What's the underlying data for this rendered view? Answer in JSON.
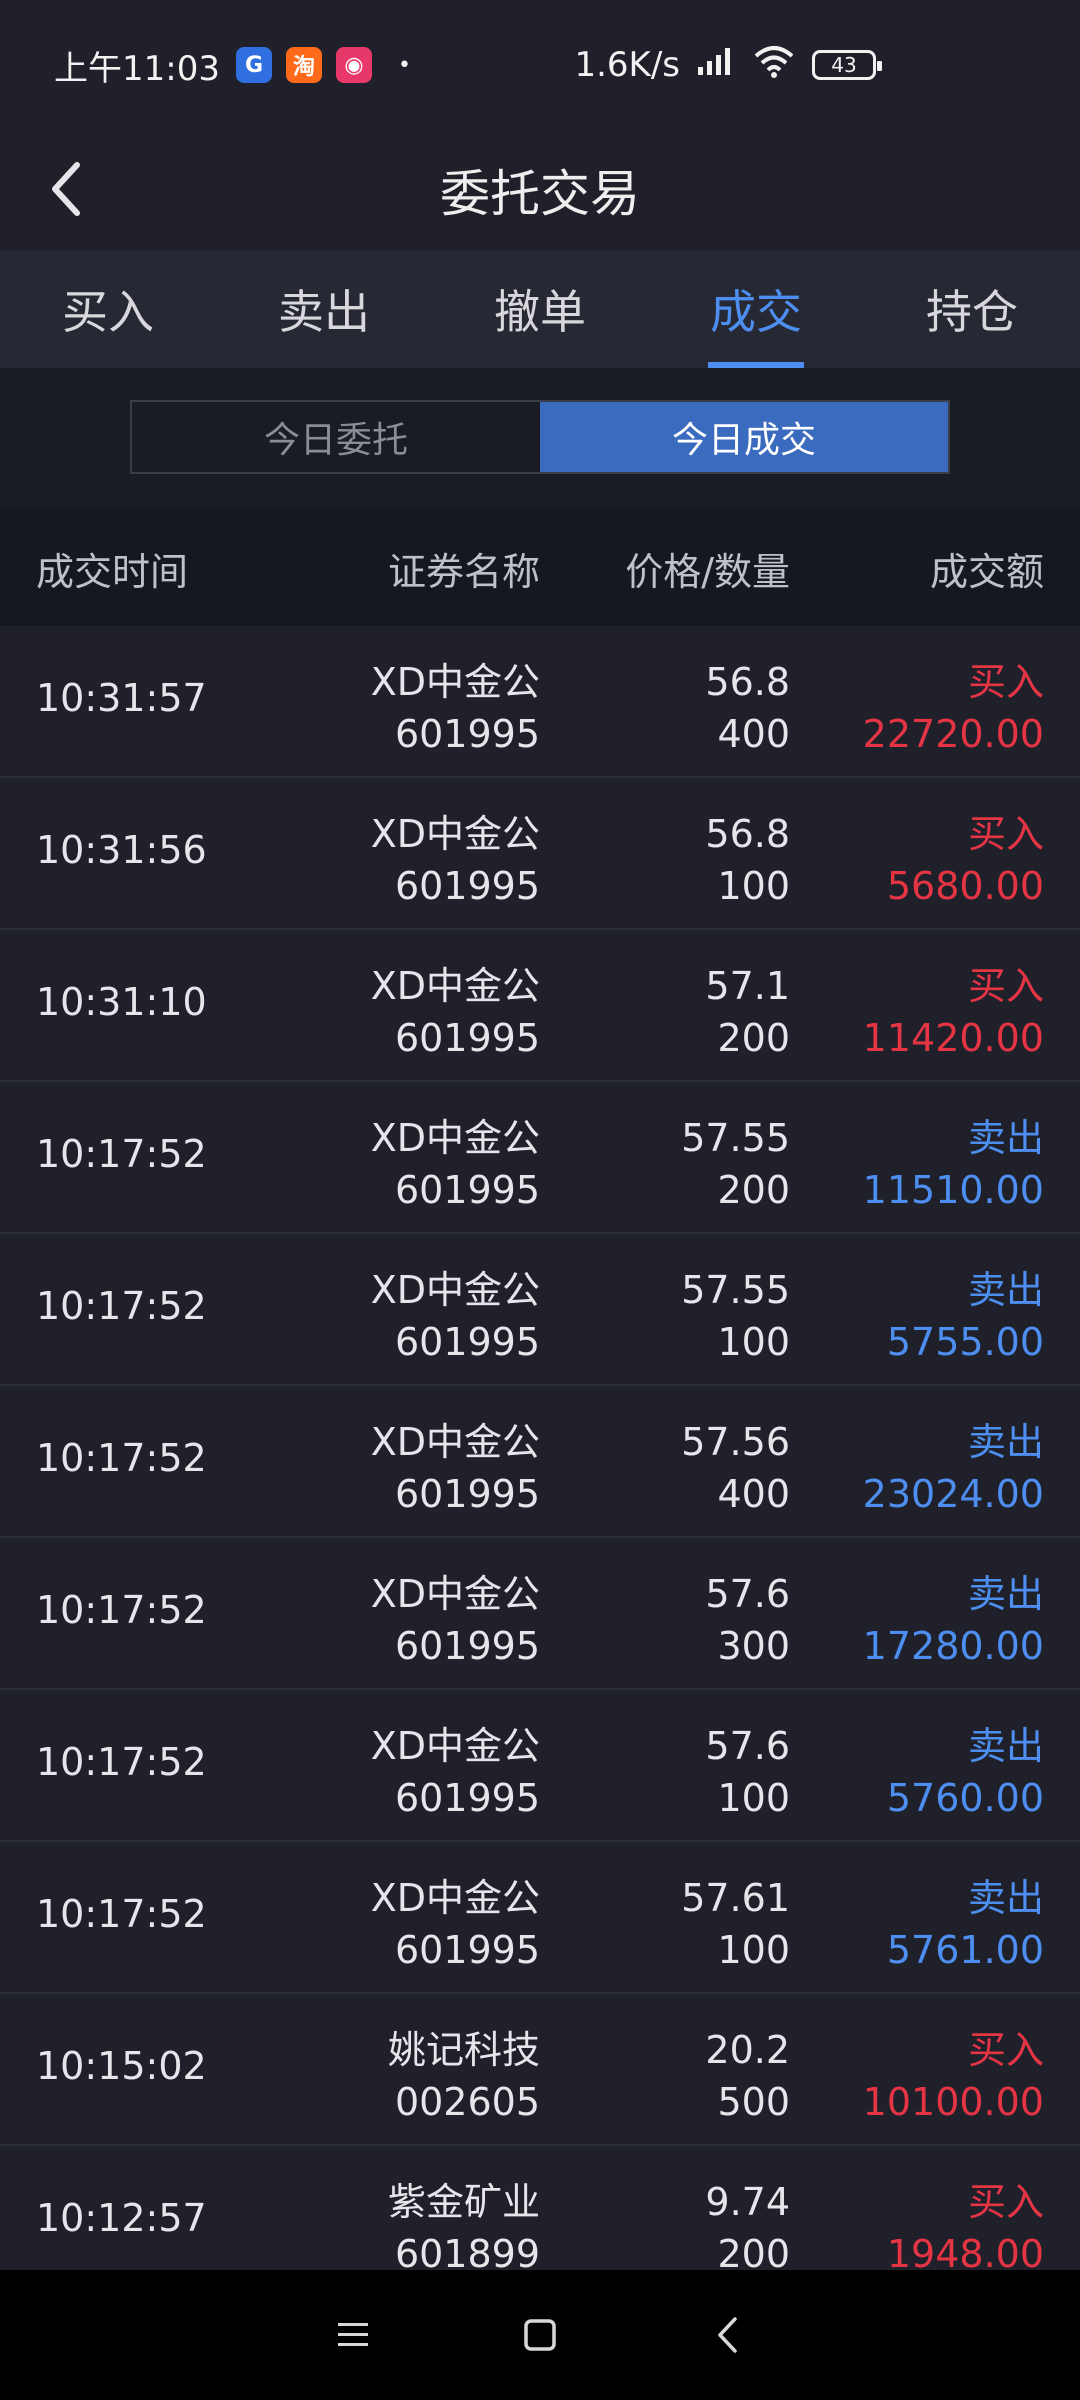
{
  "status_bar": {
    "time": "上午11:03",
    "speed": "1.6K/s",
    "battery": "43",
    "apps": [
      {
        "icon": "app-g-icon",
        "glyph": "G",
        "color": "#2f6fe0"
      },
      {
        "icon": "taobao-icon",
        "glyph": "淘",
        "color": "#ff6a1a"
      },
      {
        "icon": "app-pink-icon",
        "glyph": "◉",
        "color": "#e8386a"
      }
    ],
    "dot": "•"
  },
  "header": {
    "title": "委托交易"
  },
  "tabs": [
    {
      "label": "买入"
    },
    {
      "label": "卖出"
    },
    {
      "label": "撤单"
    },
    {
      "label": "成交",
      "active": true
    },
    {
      "label": "持仓"
    }
  ],
  "segment": {
    "left": "今日委托",
    "right": "今日成交",
    "active": "right"
  },
  "columns": {
    "time": "成交时间",
    "name": "证券名称",
    "price_qty": "价格/数量",
    "amount": "成交额"
  },
  "colors": {
    "buy": "#e53545",
    "sell": "#4d8ef0",
    "accent": "#4d8ef0"
  },
  "trades": [
    {
      "time": "10:31:57",
      "name": "XD中金公",
      "code": "601995",
      "price": "56.8",
      "qty": "400",
      "side": "买入",
      "type": "buy",
      "amount": "22720.00"
    },
    {
      "time": "10:31:56",
      "name": "XD中金公",
      "code": "601995",
      "price": "56.8",
      "qty": "100",
      "side": "买入",
      "type": "buy",
      "amount": "5680.00"
    },
    {
      "time": "10:31:10",
      "name": "XD中金公",
      "code": "601995",
      "price": "57.1",
      "qty": "200",
      "side": "买入",
      "type": "buy",
      "amount": "11420.00"
    },
    {
      "time": "10:17:52",
      "name": "XD中金公",
      "code": "601995",
      "price": "57.55",
      "qty": "200",
      "side": "卖出",
      "type": "sell",
      "amount": "11510.00"
    },
    {
      "time": "10:17:52",
      "name": "XD中金公",
      "code": "601995",
      "price": "57.55",
      "qty": "100",
      "side": "卖出",
      "type": "sell",
      "amount": "5755.00"
    },
    {
      "time": "10:17:52",
      "name": "XD中金公",
      "code": "601995",
      "price": "57.56",
      "qty": "400",
      "side": "卖出",
      "type": "sell",
      "amount": "23024.00"
    },
    {
      "time": "10:17:52",
      "name": "XD中金公",
      "code": "601995",
      "price": "57.6",
      "qty": "300",
      "side": "卖出",
      "type": "sell",
      "amount": "17280.00"
    },
    {
      "time": "10:17:52",
      "name": "XD中金公",
      "code": "601995",
      "price": "57.6",
      "qty": "100",
      "side": "卖出",
      "type": "sell",
      "amount": "5760.00"
    },
    {
      "time": "10:17:52",
      "name": "XD中金公",
      "code": "601995",
      "price": "57.61",
      "qty": "100",
      "side": "卖出",
      "type": "sell",
      "amount": "5761.00"
    },
    {
      "time": "10:15:02",
      "name": "姚记科技",
      "code": "002605",
      "price": "20.2",
      "qty": "500",
      "side": "买入",
      "type": "buy",
      "amount": "10100.00"
    },
    {
      "time": "10:12:57",
      "name": "紫金矿业",
      "code": "601899",
      "price": "9.74",
      "qty": "200",
      "side": "买入",
      "type": "buy",
      "amount": "1948.00"
    }
  ]
}
